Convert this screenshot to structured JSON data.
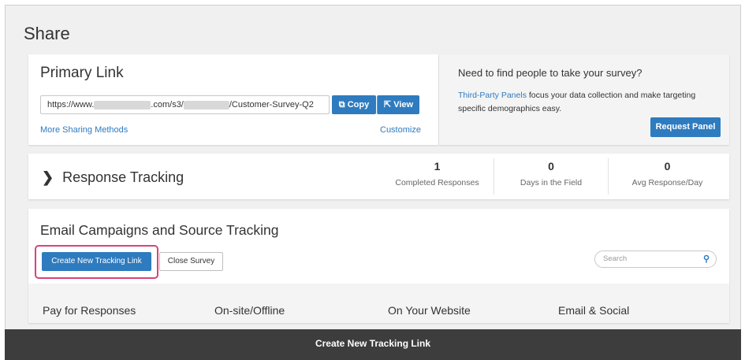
{
  "page": {
    "title": "Share"
  },
  "primary_link": {
    "title": "Primary Link",
    "url_prefix": "https://www.",
    "url_mid": ".com/s3/",
    "url_suffix": "/Customer-Survey-Q2",
    "copy_label": "Copy",
    "view_label": "View",
    "more_sharing_label": "More Sharing Methods",
    "customize_label": "Customize"
  },
  "panel": {
    "heading": "Need to find people to take your survey?",
    "link_text": "Third-Party Panels",
    "description": " focus your data collection and make targeting specific demographics easy.",
    "button_label": "Request Panel"
  },
  "response_tracking": {
    "title": "Response Tracking",
    "stats": [
      {
        "value": "1",
        "label": "Completed Responses"
      },
      {
        "value": "0",
        "label": "Days in the Field"
      },
      {
        "value": "0",
        "label": "Avg Response/Day"
      }
    ]
  },
  "email_campaigns": {
    "title": "Email Campaigns and Source Tracking",
    "create_label": "Create New Tracking Link",
    "close_label": "Close Survey",
    "search_placeholder": "Search",
    "categories": [
      "Pay for Responses",
      "On-site/Offline",
      "On Your Website",
      "Email & Social"
    ]
  },
  "caption": {
    "text": "Create New Tracking Link"
  },
  "colors": {
    "accent": "#2e7bbf",
    "highlight": "#d8437a",
    "caption_bg": "#3d3d3d"
  },
  "icons": {
    "copy": "copy-icon",
    "view": "external-link-icon",
    "chevron": "chevron-right-icon",
    "search": "search-icon"
  }
}
